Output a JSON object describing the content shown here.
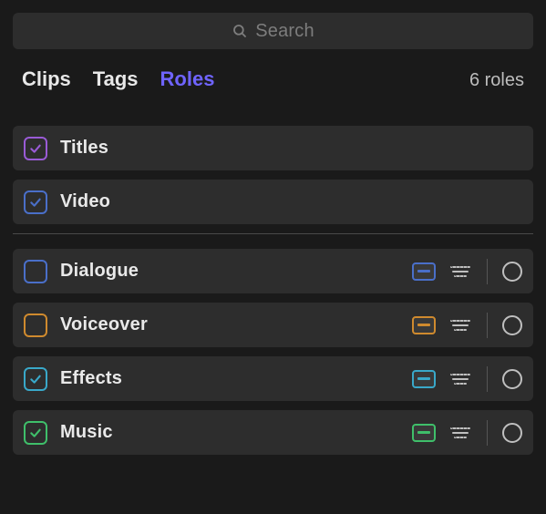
{
  "search": {
    "placeholder": "Search"
  },
  "tabs": {
    "clips": "Clips",
    "tags": "Tags",
    "roles": "Roles",
    "active": "roles"
  },
  "count_label": "6 roles",
  "colors": {
    "titles": "#9a5bd6",
    "video": "#4a6fc9",
    "dialogue": "#4a6fc9",
    "voiceover": "#cf8a2e",
    "effects": "#39a8c9",
    "music": "#3fbf6a"
  },
  "roles": {
    "video_group": [
      {
        "key": "titles",
        "label": "Titles",
        "checked": true
      },
      {
        "key": "video",
        "label": "Video",
        "checked": true
      }
    ],
    "audio_group": [
      {
        "key": "dialogue",
        "label": "Dialogue",
        "checked": false,
        "lane_active": true
      },
      {
        "key": "voiceover",
        "label": "Voiceover",
        "checked": false,
        "lane_active": true
      },
      {
        "key": "effects",
        "label": "Effects",
        "checked": true,
        "lane_active": true
      },
      {
        "key": "music",
        "label": "Music",
        "checked": true,
        "lane_active": true
      }
    ]
  }
}
